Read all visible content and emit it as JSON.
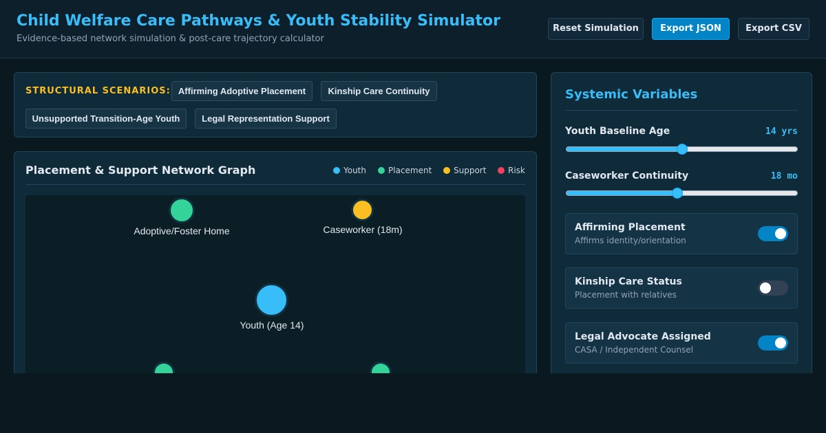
{
  "header": {
    "title": "Child Welfare Care Pathways & Youth Stability Simulator",
    "subtitle": "Evidence-based network simulation & post-care trajectory calculator",
    "buttons": {
      "reset": "Reset Simulation",
      "export_json": "Export JSON",
      "export_csv": "Export CSV"
    }
  },
  "scenarios": {
    "label": "STRUCTURAL SCENARIOS:",
    "items": [
      "Affirming Adoptive Placement",
      "Kinship Care Continuity",
      "Unsupported Transition-Age Youth",
      "Legal Representation Support"
    ]
  },
  "graph": {
    "title": "Placement & Support Network Graph",
    "legend": [
      {
        "label": "Youth",
        "color": "#38bdf8"
      },
      {
        "label": "Placement",
        "color": "#34d399"
      },
      {
        "label": "Support",
        "color": "#fbbf24"
      },
      {
        "label": "Risk",
        "color": "#f43f5e"
      }
    ],
    "nodes": {
      "youth": {
        "label": "Youth (Age 14)",
        "type": "Youth"
      },
      "home": {
        "label": "Adoptive/Foster Home",
        "type": "Placement"
      },
      "caseworker": {
        "label": "Caseworker (18m)",
        "type": "Support"
      },
      "placement_a": {
        "type": "Placement"
      },
      "placement_b": {
        "type": "Placement"
      }
    }
  },
  "sidebar": {
    "title": "Systemic Variables",
    "sliders": {
      "age": {
        "label": "Youth Baseline Age",
        "value_text": "14 yrs",
        "fraction": 0.5
      },
      "continuity": {
        "label": "Caseworker Continuity",
        "value_text": "18 mo",
        "fraction": 0.48
      }
    },
    "toggles": {
      "affirming": {
        "title": "Affirming Placement",
        "desc": "Affirms identity/orientation",
        "on": true
      },
      "kinship": {
        "title": "Kinship Care Status",
        "desc": "Placement with relatives",
        "on": false
      },
      "legal": {
        "title": "Legal Advocate Assigned",
        "desc": "CASA / Independent Counsel",
        "on": true
      }
    }
  },
  "colors": {
    "accent": "#38bdf8",
    "primary_button": "#0284c7",
    "scenario_label": "#fbbf24",
    "background": "#0a1820"
  }
}
